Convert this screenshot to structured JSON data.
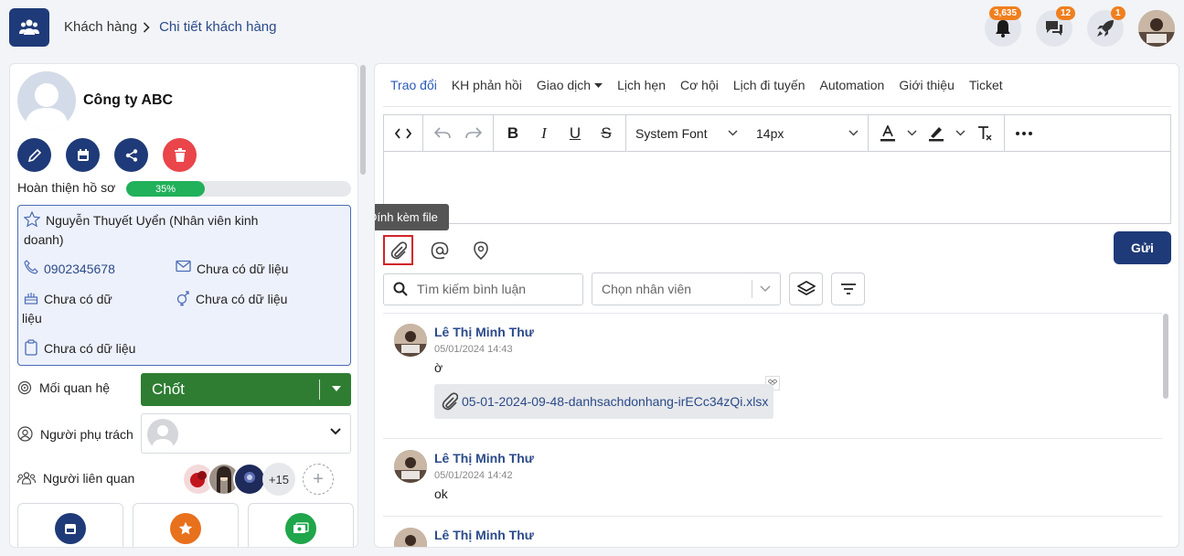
{
  "header": {
    "breadcrumb": [
      "Khách hàng",
      "Chi tiết khách hàng"
    ],
    "notifications": {
      "bell_count": "3,635",
      "chat_count": "12",
      "rocket_count": "1"
    }
  },
  "profile": {
    "company_name": "Công ty ABC",
    "progress_label": "Hoàn thiện hồ sơ",
    "progress_value": 0.35,
    "progress_text": "35%",
    "owner_line1": "Nguyễn Thuyết Uyển (Nhân viên kinh",
    "owner_line2": "doanh)",
    "phone": "0902345678",
    "email": "Chưa có dữ liệu",
    "birthday_line1": "Chưa có dữ",
    "birthday_line2": "liệu",
    "gender": "Chưa có dữ liệu",
    "note": "Chưa có dữ liệu",
    "relationship_label": "Mối quan hệ",
    "relationship_value": "Chốt",
    "responsible_label": "Người phụ trách",
    "related_label": "Người liên quan",
    "related_more": "+15"
  },
  "tabs": [
    "Trao đổi",
    "KH phản hồi",
    "Giao dịch",
    "Lịch hẹn",
    "Cơ hội",
    "Lịch đi tuyến",
    "Automation",
    "Giới thiệu",
    "Ticket"
  ],
  "editor": {
    "font_family": "System Font",
    "font_size": "14px",
    "tooltip": "Đính kèm file",
    "send_label": "Gửi"
  },
  "filters": {
    "search_placeholder": "Tìm kiếm bình luận",
    "employee_placeholder": "Chọn nhân viên"
  },
  "comments": [
    {
      "author": "Lê Thị Minh Thư",
      "time": "05/01/2024 14:43",
      "text": "ờ",
      "file": "05-01-2024-09-48-danhsachdonhang-irECc34zQi.xlsx"
    },
    {
      "author": "Lê Thị Minh Thư",
      "time": "05/01/2024 14:42",
      "text": "ok"
    },
    {
      "author": "Lê Thị Minh Thư"
    }
  ],
  "colors": {
    "primary": "#1f3a78",
    "accent_green": "#2e7d32",
    "danger": "#e9454a",
    "badge": "#f07f1e"
  }
}
